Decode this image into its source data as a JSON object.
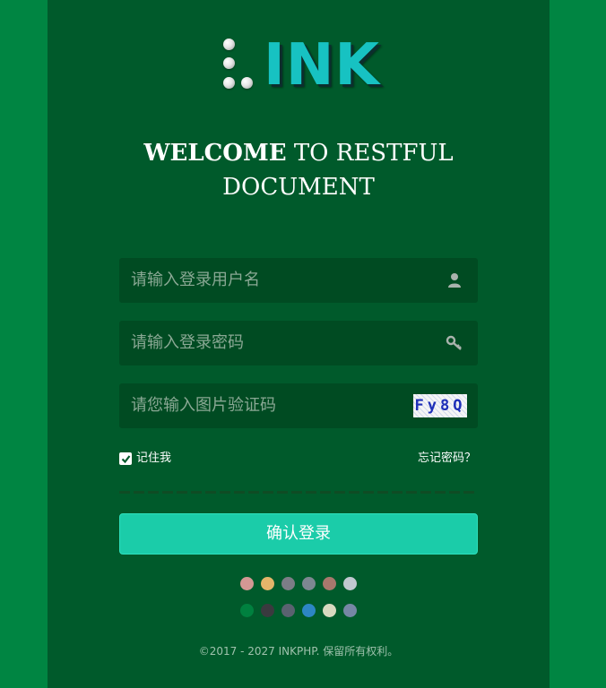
{
  "logo": {
    "text": "INK"
  },
  "welcome": {
    "bold": "WELCOME",
    "rest": " TO RESTFUL",
    "line2": "DOCUMENT"
  },
  "form": {
    "username_placeholder": "请输入登录用户名",
    "password_placeholder": "请输入登录密码",
    "captcha_placeholder": "请您输入图片验证码",
    "captcha_text": "Fy8Q",
    "remember_label": "记住我",
    "remember_checked": true,
    "forgot_label": "忘记密码？",
    "submit_label": "确认登录"
  },
  "theme_colors": {
    "row1": [
      "#d49894",
      "#e4b56a",
      "#7c7d86",
      "#7d8791",
      "#a8786d",
      "#c1c8d0"
    ],
    "row2": [
      "#00803f",
      "#3a3a3f",
      "#5a6270",
      "#2d86c4",
      "#d8d9c0",
      "#7687a5"
    ]
  },
  "footer": {
    "text": "©2017 - 2027 INKPHP. 保留所有权利。"
  },
  "colors": {
    "page_bg": "#008542",
    "panel_bg": "#005a2b",
    "field_bg": "#004b22",
    "accent": "#1bcca9",
    "logo": "#17c2c2"
  }
}
